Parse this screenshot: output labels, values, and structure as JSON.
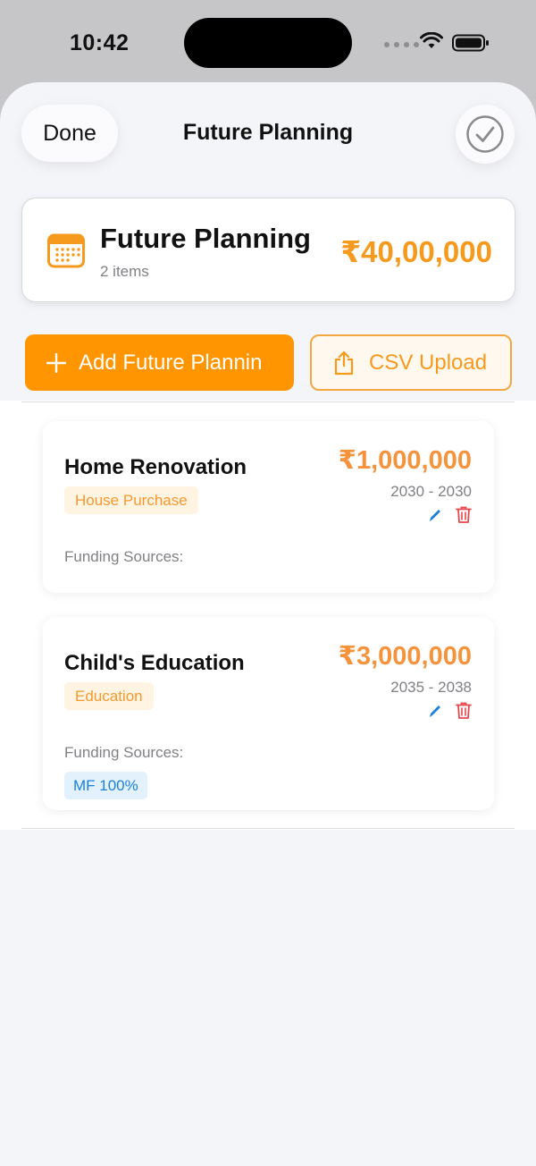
{
  "status_bar": {
    "time": "10:42"
  },
  "nav": {
    "done_label": "Done",
    "title": "Future Planning"
  },
  "summary": {
    "title": "Future Planning",
    "count": "2 items",
    "total": "₹40,00,000"
  },
  "actions": {
    "add_label": "Add Future Plannin",
    "csv_label": "CSV Upload"
  },
  "goals": [
    {
      "name": "Home Renovation",
      "category": "House Purchase",
      "amount": "₹1,000,000",
      "years": "2030 - 2030",
      "funding_label": "Funding Sources:",
      "funding": []
    },
    {
      "name": "Child's Education",
      "category": "Education",
      "amount": "₹3,000,000",
      "years": "2035 - 2038",
      "funding_label": "Funding Sources:",
      "funding": [
        "MF 100%"
      ]
    }
  ],
  "colors": {
    "accent": "#ff9500",
    "amount": "#f5933c",
    "edit": "#1a80d9",
    "delete": "#e5484d"
  },
  "icons": [
    "wifi-icon",
    "battery-icon",
    "checkmark-circle-icon",
    "calendar-icon",
    "plus-icon",
    "share-upload-icon",
    "pencil-icon",
    "trash-icon"
  ]
}
